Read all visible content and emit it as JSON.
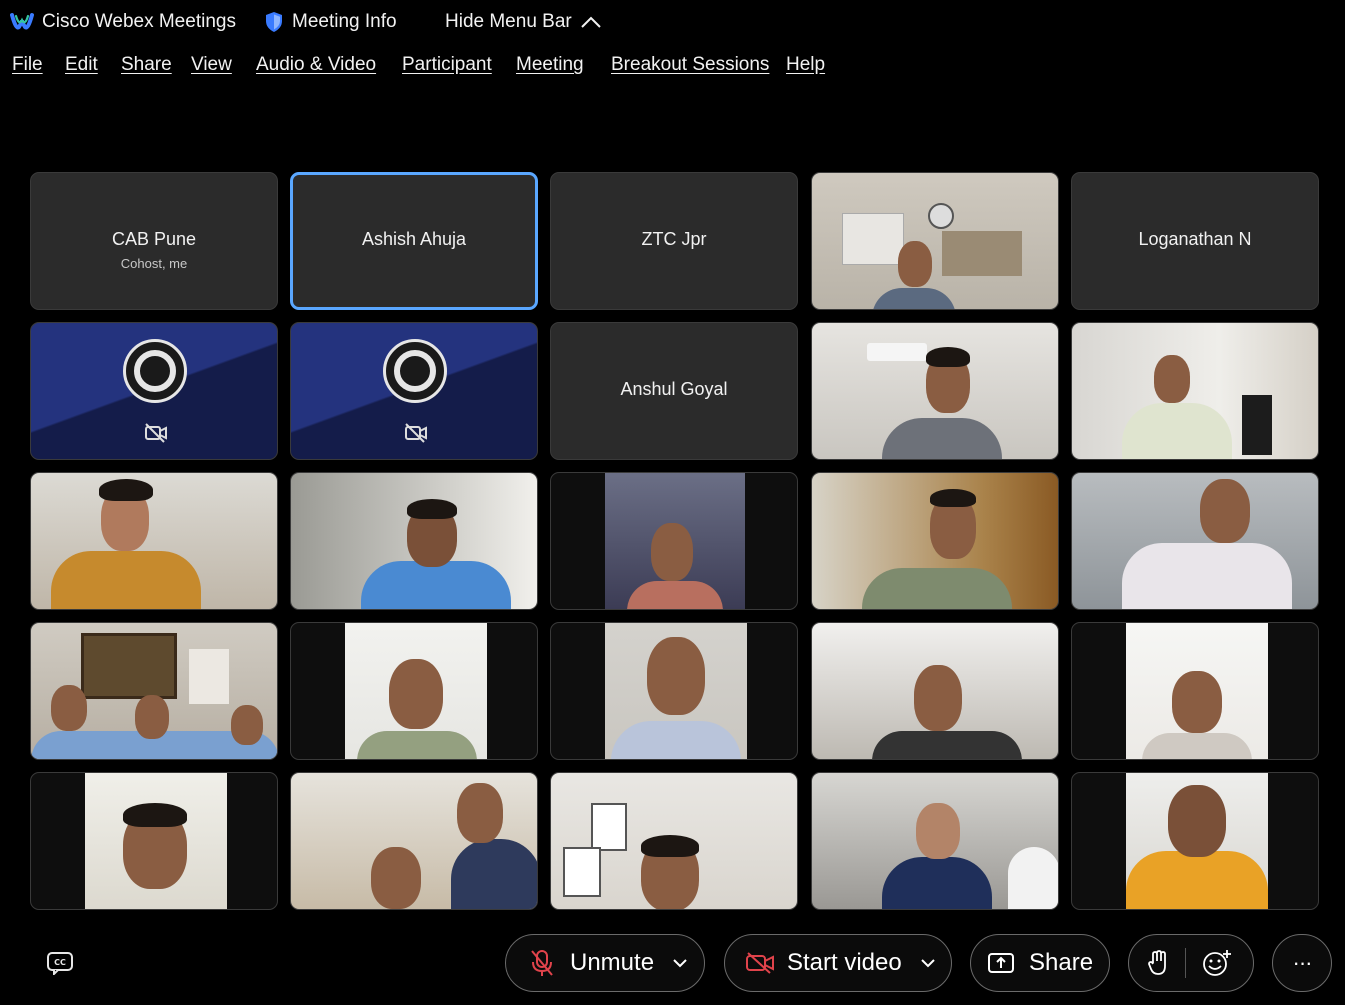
{
  "titlebar": {
    "app_name": "Cisco Webex Meetings",
    "meeting_info": "Meeting Info",
    "hide_menu_bar": "Hide Menu Bar"
  },
  "menu": [
    "File",
    "Edit",
    "Share",
    "View",
    "Audio & Video",
    "Participant",
    "Meeting",
    "Breakout Sessions",
    "Help"
  ],
  "tiles": {
    "cab_pune": {
      "name": "CAB Pune",
      "sub": "Cohost, me"
    },
    "ashish": {
      "name": "Ashish Ahuja"
    },
    "ztc": {
      "name": "ZTC Jpr"
    },
    "loganathan": {
      "name": "Loganathan N"
    },
    "anshul": {
      "name": "Anshul Goyal"
    }
  },
  "controls": {
    "unmute": "Unmute",
    "start_video": "Start video",
    "share": "Share",
    "more": "···"
  },
  "colors": {
    "background": "#000000",
    "tile": "#2b2b2b",
    "active_border": "#5aa7ff",
    "mute_red": "#e0434b",
    "obs_blue": "#24337e"
  },
  "icons": {
    "app": "webex-logo-icon",
    "meeting_info": "shield-icon",
    "hide": "chevron-up-icon",
    "cc": "closed-captions-icon",
    "mic": "mic-muted-icon",
    "video": "video-off-icon",
    "share": "share-icon",
    "hand": "raise-hand-icon",
    "reactions": "reactions-icon",
    "more": "more-icon"
  }
}
